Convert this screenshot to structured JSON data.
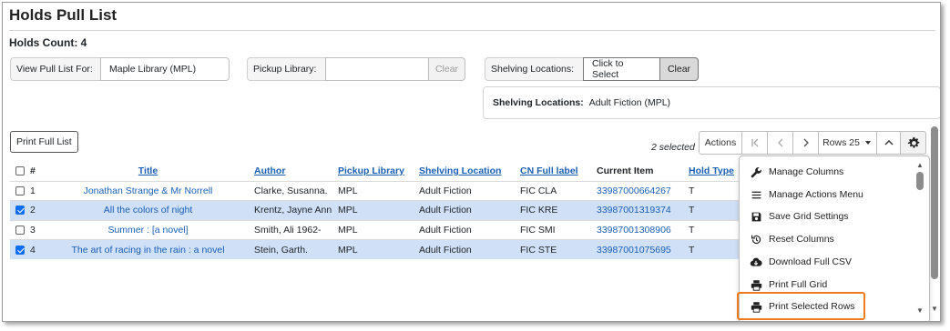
{
  "page": {
    "title": "Holds Pull List",
    "holds_count": "Holds Count: 4"
  },
  "filters": {
    "view_label": "View Pull List For:",
    "view_value": "Maple Library (MPL)",
    "pickup_label": "Pickup Library:",
    "pickup_value": "",
    "clear_label": "Clear",
    "shelving_label": "Shelving Locations:",
    "shelving_select": "Click to Select",
    "shelving_clear": "Clear",
    "shelving_summary_label": "Shelving Locations:",
    "shelving_summary_value": "Adult Fiction (MPL)"
  },
  "toolbar": {
    "print_full": "Print Full List",
    "selected": "2 selected",
    "actions": "Actions",
    "rows": "Rows 25"
  },
  "table": {
    "headers": {
      "num": "#",
      "title": "Title",
      "author": "Author",
      "pickup": "Pickup Library",
      "shelving": "Shelving Location",
      "cn": "CN Full label",
      "item": "Current Item",
      "hold_type": "Hold Type"
    },
    "rows": [
      {
        "selected": false,
        "num": "1",
        "title": "Jonathan Strange & Mr Norrell",
        "author": "Clarke, Susanna.",
        "pickup": "MPL",
        "shelving": "Adult Fiction",
        "cn": "FIC CLA",
        "item": "33987000664267",
        "hold_type": "T"
      },
      {
        "selected": true,
        "num": "2",
        "title": "All the colors of night",
        "author": "Krentz, Jayne Ann",
        "pickup": "MPL",
        "shelving": "Adult Fiction",
        "cn": "FIC KRE",
        "item": "33987001319374",
        "hold_type": "T"
      },
      {
        "selected": false,
        "num": "3",
        "title": "Summer : [a novel]",
        "author": "Smith, Ali 1962-",
        "pickup": "MPL",
        "shelving": "Adult Fiction",
        "cn": "FIC SMI",
        "item": "33987001308906",
        "hold_type": "T"
      },
      {
        "selected": true,
        "num": "4",
        "title": "The art of racing in the rain : a novel",
        "author": "Stein, Garth.",
        "pickup": "MPL",
        "shelving": "Adult Fiction",
        "cn": "FIC STE",
        "item": "33987001075695",
        "hold_type": "T"
      }
    ]
  },
  "menu": {
    "items": [
      {
        "label": "Manage Columns",
        "icon": "wrench-icon"
      },
      {
        "label": "Manage Actions Menu",
        "icon": "list-icon"
      },
      {
        "label": "Save Grid Settings",
        "icon": "save-icon"
      },
      {
        "label": "Reset Columns",
        "icon": "history-icon"
      },
      {
        "label": "Download Full CSV",
        "icon": "cloud-download-icon"
      },
      {
        "label": "Print Full Grid",
        "icon": "printer-icon"
      },
      {
        "label": "Print Selected Rows",
        "icon": "printer-icon"
      }
    ]
  },
  "colors": {
    "link": "#1a5fb4",
    "selected_row": "#cfe0f7",
    "highlight": "#f07b1f",
    "checkbox": "#0d6efd"
  }
}
